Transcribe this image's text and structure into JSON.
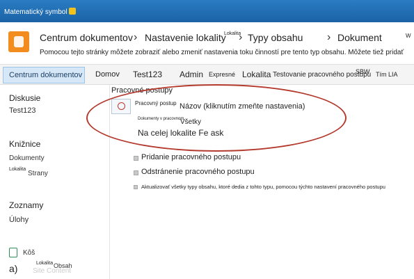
{
  "topbar": {
    "title": "Matematický symbol"
  },
  "breadcrumb": {
    "items": [
      "Centrum dokumentov",
      "Nastavenie lokality",
      "Typy obsahu",
      "Dokument"
    ],
    "sup_lokalita": "Lokalita",
    "trailing": "W",
    "description": "Pomocou tejto stránky môžete zobraziť alebo zmeniť nastavenia toku činností pre tento typ obsahu. Môžete tiež pridať"
  },
  "nav": {
    "selected": "Centrum dokumentov",
    "items": [
      "Domov",
      "Test123",
      "Admin",
      "Expresné",
      "Lokalita",
      "Testovanie pracovného postupu",
      "SBW",
      "Tím LIA"
    ]
  },
  "left": {
    "sections": [
      {
        "heading": "Diskusie",
        "items": [
          "Test123"
        ]
      },
      {
        "heading": "Knižnice",
        "items": [
          "Dokumenty",
          "Strany"
        ]
      },
      {
        "heading": "Zoznamy",
        "items": [
          "Úlohy"
        ]
      }
    ],
    "lokalita_small": "Lokalita",
    "footer_item": "Kôš",
    "footer_a": "a)",
    "footer_obsah": "Obsah",
    "footer_ghost": "Site Content"
  },
  "main": {
    "section_title": "Pracovné postupy",
    "table": {
      "col1": "Pracovný postup",
      "col2": "Názov (kliknutím zmeňte nastavenia)",
      "sub_label": "Dokumenty v pracovnom",
      "sub_value": "Všetky",
      "scope": "Na celej lokalite Fe ask"
    },
    "actions": [
      "Pridanie pracovného postupu",
      "Odstránenie pracovného postupu",
      "Aktualizovať všetky typy obsahu, ktoré dedia z tohto typu, pomocou týchto nastavení pracovného postupu"
    ]
  }
}
